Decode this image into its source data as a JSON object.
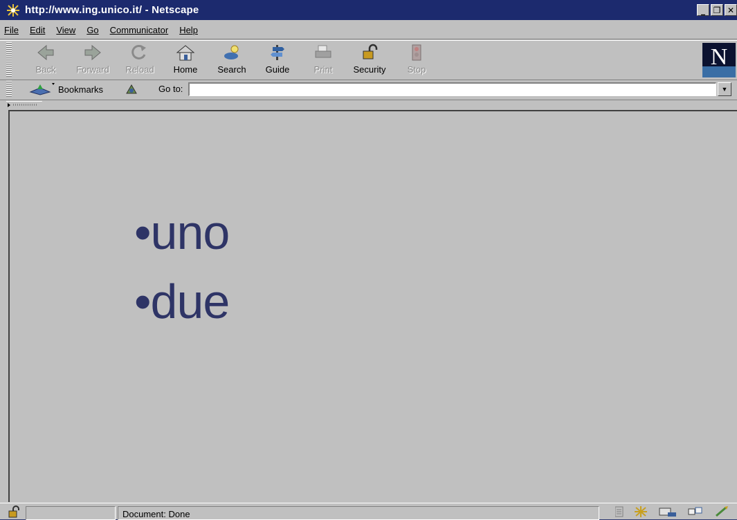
{
  "window": {
    "title": "http://www.ing.unico.it/ - Netscape",
    "controls": [
      "_",
      "❐",
      "✕"
    ]
  },
  "menubar": {
    "items": [
      {
        "label": "File",
        "hotkey_index": 0
      },
      {
        "label": "Edit",
        "hotkey_index": 0
      },
      {
        "label": "View",
        "hotkey_index": 0
      },
      {
        "label": "Go",
        "hotkey_index": 0
      },
      {
        "label": "Communicator",
        "hotkey_index": 0
      },
      {
        "label": "Help",
        "hotkey_index": 0
      }
    ]
  },
  "toolbar": {
    "buttons": [
      {
        "label": "Back",
        "icon": "back-arrow-icon",
        "enabled": false
      },
      {
        "label": "Forward",
        "icon": "forward-arrow-icon",
        "enabled": false
      },
      {
        "label": "Reload",
        "icon": "reload-icon",
        "enabled": false
      },
      {
        "label": "Home",
        "icon": "home-icon",
        "enabled": true
      },
      {
        "label": "Search",
        "icon": "search-icon",
        "enabled": true
      },
      {
        "label": "Guide",
        "icon": "guide-icon",
        "enabled": true
      },
      {
        "label": "Print",
        "icon": "print-icon",
        "enabled": false
      },
      {
        "label": "Security",
        "icon": "security-lock-icon",
        "enabled": true
      },
      {
        "label": "Stop",
        "icon": "stop-icon",
        "enabled": false
      }
    ],
    "logo": "N"
  },
  "location": {
    "bookmarks_label": "Bookmarks",
    "goto_label": "Go to:",
    "url_value": ""
  },
  "content": {
    "bullets": [
      "•uno",
      "•due"
    ]
  },
  "status": {
    "text": "Document: Done"
  },
  "colors": {
    "title_bar": "#1c2a6e",
    "desktop": "#2f3a73",
    "chrome": "#c0c0c0",
    "content_text": "#2e3466"
  }
}
